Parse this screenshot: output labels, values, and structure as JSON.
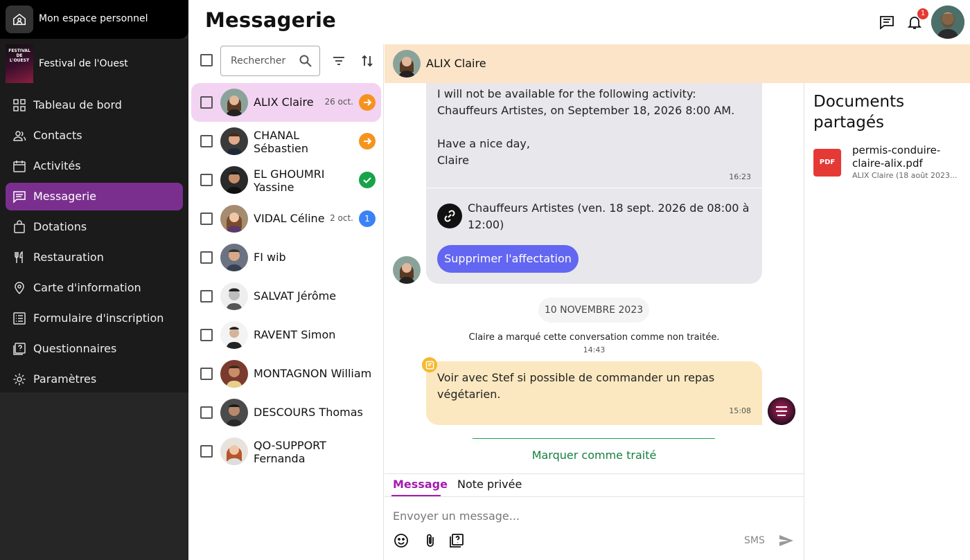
{
  "sidebar": {
    "personal_space": "Mon espace personnel",
    "event_name": "Festival de l'Ouest",
    "event_logo_text": "FESTIVAL DE L'OUEST",
    "items": [
      {
        "label": "Tableau de bord",
        "icon": "dashboard-icon"
      },
      {
        "label": "Contacts",
        "icon": "contacts-icon"
      },
      {
        "label": "Activités",
        "icon": "calendar-icon"
      },
      {
        "label": "Messagerie",
        "icon": "chat-icon",
        "active": true
      },
      {
        "label": "Dotations",
        "icon": "bag-icon"
      },
      {
        "label": "Restauration",
        "icon": "cutlery-icon"
      },
      {
        "label": "Carte d'information",
        "icon": "map-pin-icon"
      },
      {
        "label": "Formulaire d'inscription",
        "icon": "form-icon"
      },
      {
        "label": "Questionnaires",
        "icon": "questionnaire-icon"
      },
      {
        "label": "Paramètres",
        "icon": "gear-icon"
      }
    ]
  },
  "header": {
    "title": "Messagerie",
    "notif_count": "1"
  },
  "list": {
    "search_placeholder": "Rechercher",
    "conversations": [
      {
        "name1": "ALIX Claire",
        "name2": "",
        "date": "26 oct.",
        "status": "arrow",
        "active": true
      },
      {
        "name1": "CHANAL",
        "name2": "Sébastien",
        "date": "",
        "status": "arrow"
      },
      {
        "name1": "EL GHOUMRI",
        "name2": "Yassine",
        "date": "",
        "status": "check"
      },
      {
        "name1": "VIDAL Céline",
        "name2": "",
        "date": "2 oct.",
        "status": "count",
        "count": "1"
      },
      {
        "name1": "FI wib",
        "name2": "",
        "date": "",
        "status": ""
      },
      {
        "name1": "SALVAT Jérôme",
        "name2": "",
        "date": "",
        "status": ""
      },
      {
        "name1": "RAVENT Simon",
        "name2": "",
        "date": "",
        "status": ""
      },
      {
        "name1": "MONTAGNON William",
        "name2": "",
        "date": "",
        "status": ""
      },
      {
        "name1": "DESCOURS Thomas",
        "name2": "",
        "date": "",
        "status": ""
      },
      {
        "name1": "QO-SUPPORT",
        "name2": "Fernanda",
        "date": "",
        "status": ""
      }
    ]
  },
  "chat": {
    "contact_name": "ALIX Claire",
    "msg1": {
      "line1": "I will not be available for the following activity:",
      "line2": "Chauffeurs Artistes, on September 18, 2026 8:00 AM.",
      "line3": "Have a nice day,",
      "line4": "Claire",
      "time": "16:23"
    },
    "assignment": {
      "line1": "Chauffeurs Artistes (ven. 18 sept. 2026 de 08:00 à",
      "line2": "12:00)",
      "button": "Supprimer l'affectation"
    },
    "date_separator": "10 NOVEMBRE 2023",
    "system_note": "Claire a marqué cette conversation comme non traitée.",
    "system_time": "14:43",
    "note": {
      "line1": "Voir avec Stef si possible de commander un repas",
      "line2": "végétarien.",
      "time": "15:08"
    },
    "mark_done": "Marquer comme traité"
  },
  "composer": {
    "tab_message": "Message",
    "tab_note": "Note privée",
    "placeholder": "Envoyer un message...",
    "sms": "SMS"
  },
  "docs": {
    "title_line1": "Documents",
    "title_line2": "partagés",
    "file_badge": "PDF",
    "file_name1": "permis-conduire-",
    "file_name2": "claire-alix.pdf",
    "file_meta": "ALIX Claire (18 août 2023..."
  }
}
